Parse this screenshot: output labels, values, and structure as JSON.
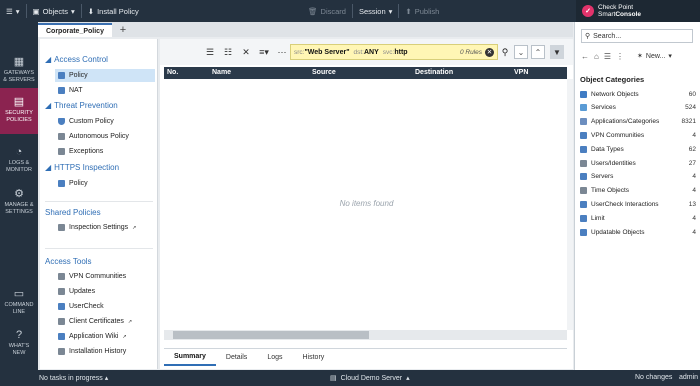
{
  "topbar": {
    "menu_icon": "app-menu-icon",
    "objects_label": "Objects",
    "install_label": "Install Policy",
    "discard_label": "Discard",
    "session_label": "Session",
    "publish_label": "Publish"
  },
  "brand": {
    "line1": "Check Point",
    "line2_a": "Smart",
    "line2_b": "Console",
    "color": "#e2336b"
  },
  "rail": [
    {
      "label1": "GATEWAYS",
      "label2": "& SERVERS",
      "icon": "gateways-icon"
    },
    {
      "label1": "SECURITY",
      "label2": "POLICIES",
      "icon": "security-policies-icon"
    },
    {
      "label1": "LOGS &",
      "label2": "MONITOR",
      "icon": "logs-icon"
    },
    {
      "label1": "MANAGE &",
      "label2": "SETTINGS",
      "icon": "settings-icon"
    },
    {
      "label1": "COMMAND",
      "label2": "LINE",
      "icon": "command-line-icon"
    },
    {
      "label1": "WHAT'S",
      "label2": "NEW",
      "icon": "whats-new-icon"
    }
  ],
  "tabs": {
    "active": "Corporate_Policy",
    "add": "+"
  },
  "nav": {
    "access_control": "Access Control",
    "policy": "Policy",
    "nat": "NAT",
    "threat_prevention": "Threat Prevention",
    "custom_policy": "Custom Policy",
    "autonomous_policy": "Autonomous Policy",
    "exceptions": "Exceptions",
    "https_inspection": "HTTPS Inspection",
    "https_policy": "Policy",
    "shared_policies": "Shared Policies",
    "inspection_settings": "Inspection Settings",
    "access_tools": "Access Tools",
    "vpn_communities": "VPN Communities",
    "updates": "Updates",
    "usercheck": "UserCheck",
    "client_certificates": "Client Certificates",
    "application_wiki": "Application Wiki",
    "installation_history": "Installation History"
  },
  "search": {
    "src_key": "src:",
    "src_val": "\"Web Server\"",
    "dst_key": "dst:",
    "dst_val": "ANY",
    "svc_key": "svc:",
    "svc_val": "http",
    "count": "0 Rules"
  },
  "grid": {
    "columns": [
      "No.",
      "Name",
      "Source",
      "Destination",
      "VPN"
    ],
    "empty": "No items found"
  },
  "bottom_tabs": [
    "Summary",
    "Details",
    "Logs",
    "History"
  ],
  "right": {
    "search_placeholder": "Search...",
    "new_label": "New...",
    "title": "Object Categories",
    "categories": [
      {
        "name": "Network Objects",
        "count": "60",
        "color": "#3f7cc4"
      },
      {
        "name": "Services",
        "count": "524",
        "color": "#5a9bd5"
      },
      {
        "name": "Applications/Categories",
        "count": "8321",
        "color": "#6c8ebf"
      },
      {
        "name": "VPN Communities",
        "count": "4",
        "color": "#4b7fc0"
      },
      {
        "name": "Data Types",
        "count": "62",
        "color": "#4b7fc0"
      },
      {
        "name": "Users/Identities",
        "count": "27",
        "color": "#7b8794"
      },
      {
        "name": "Servers",
        "count": "4",
        "color": "#4b7fc0"
      },
      {
        "name": "Time Objects",
        "count": "4",
        "color": "#7b8794"
      },
      {
        "name": "UserCheck Interactions",
        "count": "13",
        "color": "#4b7fc0"
      },
      {
        "name": "Limit",
        "count": "4",
        "color": "#4b7fc0"
      },
      {
        "name": "Updatable Objects",
        "count": "4",
        "color": "#4b7fc0"
      }
    ]
  },
  "status": {
    "tasks": "No tasks in progress",
    "server": "Cloud Demo Server",
    "changes": "No changes",
    "user": "admin"
  }
}
